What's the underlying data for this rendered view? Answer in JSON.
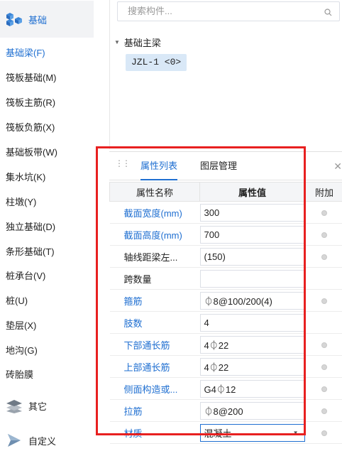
{
  "sidebar": {
    "group_foundation": {
      "label": "基础",
      "icon": "foundation-blocks-icon"
    },
    "items": [
      {
        "label": "基础梁(F)"
      },
      {
        "label": "筏板基础(M)"
      },
      {
        "label": "筏板主筋(R)"
      },
      {
        "label": "筏板负筋(X)"
      },
      {
        "label": "基础板带(W)"
      },
      {
        "label": "集水坑(K)"
      },
      {
        "label": "柱墩(Y)"
      },
      {
        "label": "独立基础(D)"
      },
      {
        "label": "条形基础(T)"
      },
      {
        "label": "桩承台(V)"
      },
      {
        "label": "桩(U)"
      },
      {
        "label": "垫层(X)"
      },
      {
        "label": "地沟(G)"
      },
      {
        "label": "砖胎膜"
      }
    ],
    "group_other": {
      "label": "其它",
      "icon": "layers-icon"
    },
    "group_custom": {
      "label": "自定义",
      "icon": "custom-arrow-icon"
    }
  },
  "component_panel": {
    "search_placeholder": "搜索构件...",
    "tree_group": "基础主梁",
    "tree_item": "JZL-1 <0>"
  },
  "property_panel": {
    "tabs": [
      "属性列表",
      "图层管理"
    ],
    "columns": [
      "属性名称",
      "属性值",
      "附加"
    ],
    "rows": [
      {
        "name": "截面宽度(mm)",
        "value": "300",
        "color": "blue"
      },
      {
        "name": "截面高度(mm)",
        "value": "700",
        "color": "blue"
      },
      {
        "name": "轴线距梁左...",
        "value": "(150)",
        "color": "black"
      },
      {
        "name": "跨数量",
        "value": "",
        "color": "black"
      },
      {
        "name": "箍筋",
        "value": "⏀8@100/200(4)",
        "color": "blue"
      },
      {
        "name": "肢数",
        "value": "4",
        "color": "blue"
      },
      {
        "name": "下部通长筋",
        "value": "4⏀22",
        "color": "blue"
      },
      {
        "name": "上部通长筋",
        "value": "4⏀22",
        "color": "blue"
      },
      {
        "name": "侧面构造或...",
        "value": "G4⏀12",
        "color": "blue"
      },
      {
        "name": "拉筋",
        "value": "⏀8@200",
        "color": "blue"
      },
      {
        "name": "材质",
        "value": "混凝土",
        "color": "blue",
        "select": true
      }
    ]
  },
  "colors": {
    "accent": "#1f6fd1",
    "highlight": "#e82020"
  }
}
